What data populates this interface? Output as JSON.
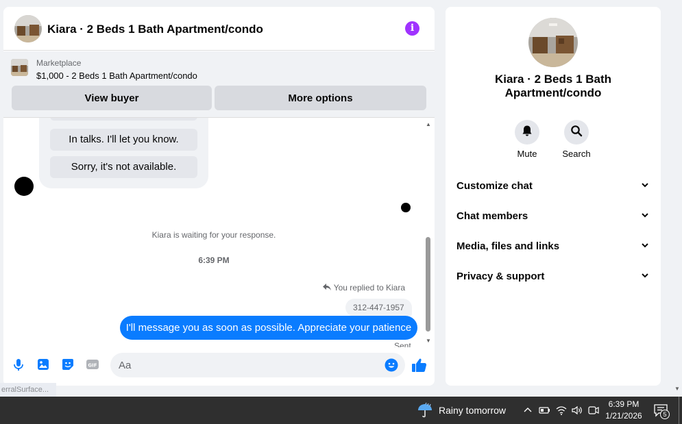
{
  "chat": {
    "header_title": "Kiara · 2 Beds 1 Bath Apartment/condo",
    "marketplace_label": "Marketplace",
    "listing": "$1,000 - 2 Beds 1 Bath Apartment/condo",
    "view_buyer": "View buyer",
    "more_options": "More options",
    "quick_replies": [
      "In talks. I'll let you know.",
      "Sorry, it's not available."
    ],
    "waiting": "Kiara is waiting for your response.",
    "time_separator": "6:39 PM",
    "replied_label": "You replied to Kiara",
    "quoted_message": "312-447-1957",
    "outgoing_message": "I'll message you as soon as possible. Appreciate your patience",
    "status": "Sent",
    "input_placeholder": "Aa",
    "accent_color": "#0a7cff"
  },
  "info": {
    "title": "Kiara · 2 Beds 1 Bath Apartment/condo",
    "actions": [
      {
        "label": "Mute",
        "icon": "bell-icon"
      },
      {
        "label": "Search",
        "icon": "search-icon"
      }
    ],
    "rows": [
      "Customize chat",
      "Chat members",
      "Media, files and links",
      "Privacy & support"
    ]
  },
  "ghost_label": "erralSurface...",
  "taskbar": {
    "weather": "Rainy tomorrow",
    "time": "6:39 PM",
    "date": "1/21/2026",
    "notification_count": "5"
  }
}
